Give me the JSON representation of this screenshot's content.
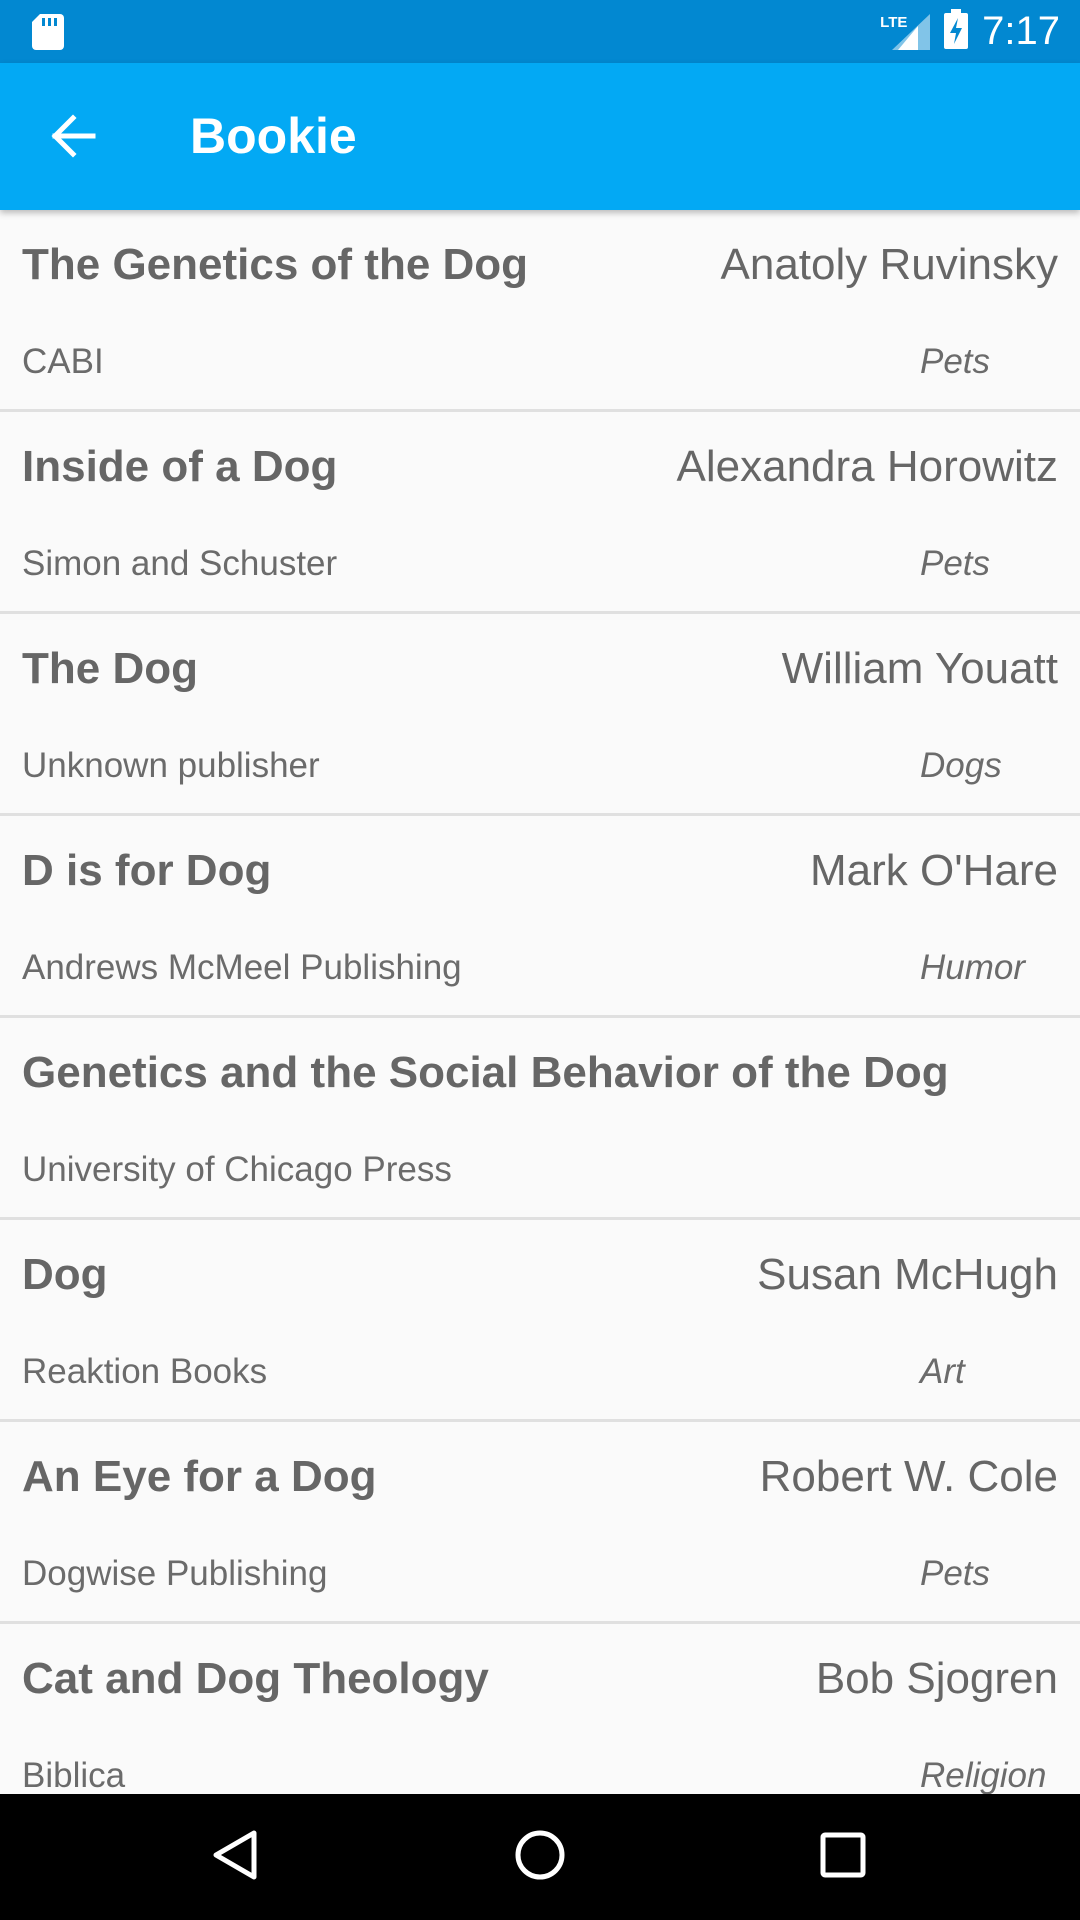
{
  "status_bar": {
    "time": "7:17",
    "network_label": "LTE",
    "icons": [
      "sd-card-icon",
      "signal-icon",
      "battery-charging-icon"
    ]
  },
  "app_bar": {
    "title": "Bookie",
    "back_icon": "arrow-back-icon"
  },
  "books": [
    {
      "title": "The Genetics of the Dog",
      "author": "Anatoly Ruvinsky",
      "publisher": "CABI",
      "category": "Pets"
    },
    {
      "title": "Inside of a Dog",
      "author": "Alexandra Horowitz",
      "publisher": "Simon and Schuster",
      "category": "Pets"
    },
    {
      "title": "The Dog",
      "author": "William Youatt",
      "publisher": "Unknown publisher",
      "category": "Dogs"
    },
    {
      "title": "D is for Dog",
      "author": "Mark O'Hare",
      "publisher": "Andrews McMeel Publishing",
      "category": "Humor"
    },
    {
      "title": "Genetics and the Social Behavior of the Dog",
      "author": "",
      "publisher": "University of Chicago Press",
      "category": ""
    },
    {
      "title": "Dog",
      "author": "Susan McHugh",
      "publisher": "Reaktion Books",
      "category": "Art"
    },
    {
      "title": "An Eye for a Dog",
      "author": "Robert W. Cole",
      "publisher": "Dogwise Publishing",
      "category": "Pets"
    },
    {
      "title": "Cat and Dog Theology",
      "author": "Bob Sjogren",
      "publisher": "Biblica",
      "category": "Religion"
    }
  ],
  "nav_bar": {
    "icons": [
      "back-triangle-icon",
      "home-circle-icon",
      "recents-square-icon"
    ]
  },
  "colors": {
    "status_bar": "#0288d1",
    "app_bar": "#03a9f4",
    "text": "#666666",
    "background": "#fafafa"
  }
}
